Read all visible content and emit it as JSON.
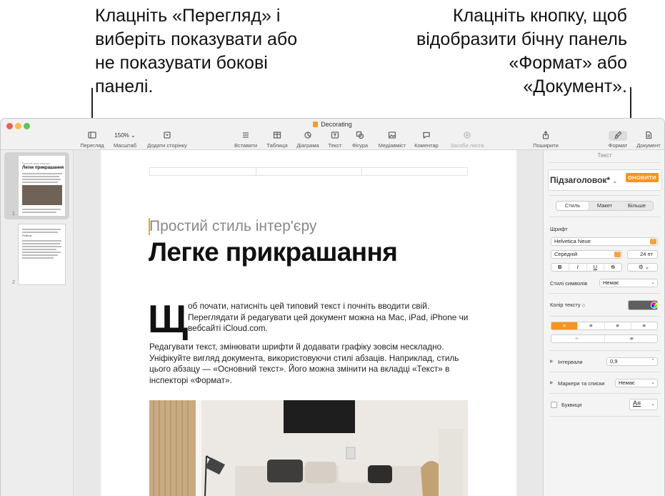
{
  "callouts": {
    "left": "Клацніть «Перегляд» і виберіть показувати або не показувати бокові панелі.",
    "right": "Клацніть кнопку, щоб відобразити бічну панель «Формат» або «Документ»."
  },
  "window": {
    "title": "Decorating"
  },
  "toolbar": {
    "view": "Перегляд",
    "zoom_value": "150%",
    "zoom": "Масштаб",
    "add_page": "Додати сторінку",
    "insert": "Вставити",
    "table": "Таблиця",
    "chart": "Діаграма",
    "text": "Текст",
    "shape": "Фігура",
    "media": "Медіавміст",
    "comment": "Коментар",
    "mail": "Засоби листа",
    "share": "Поширити",
    "format": "Формат",
    "document": "Документ"
  },
  "sidebar": {
    "pages": [
      {
        "number": "1",
        "mini_subtitle": "Простий стиль інтер'єру",
        "mini_title": "Легке прикрашання"
      },
      {
        "number": "2",
        "mini_title": "Роботи"
      }
    ]
  },
  "document": {
    "subtitle": "Простий стиль інтер'єру",
    "title": "Легке прикрашання",
    "dropcap": "Щ",
    "para1": "об почати, натисніть цей типовий текст і почніть вводити свій. Переглядати й редагувати цей документ можна на Mac, iPad, iPhone чи вебсайті iCloud.com.",
    "para2": "Редагувати текст, змінювати шрифти й додавати графіку зовсім нескладно. Уніфікуйте вигляд документа, використовуючи стилі абзаців. Наприклад, стиль цього абзацу — «Основний текст». Його можна змінити на вкладці «Текст» в інспекторі «Формат»."
  },
  "inspector": {
    "header": "Текст",
    "paragraph_style": "Підзаголовок*",
    "update": "ОНОВИТИ",
    "tabs": [
      "Стиль",
      "Макет",
      "Більше"
    ],
    "font_label": "Шрифт",
    "font_name": "Helvetica Neue",
    "font_weight": "Середній",
    "font_size": "24 пт",
    "style_buttons": [
      "B",
      "I",
      "U",
      "S"
    ],
    "char_styles_label": "Стилі символів",
    "char_styles_value": "Немає",
    "text_color_label": "Колір тексту",
    "spacing_label": "Інтервали",
    "spacing_value": "0,9",
    "bullets_label": "Маркери та списки",
    "bullets_value": "Немає",
    "dropcap_label": "Буквиця",
    "colors": {
      "accent": "#f7941d",
      "text_color": "#5f5f5f"
    }
  }
}
